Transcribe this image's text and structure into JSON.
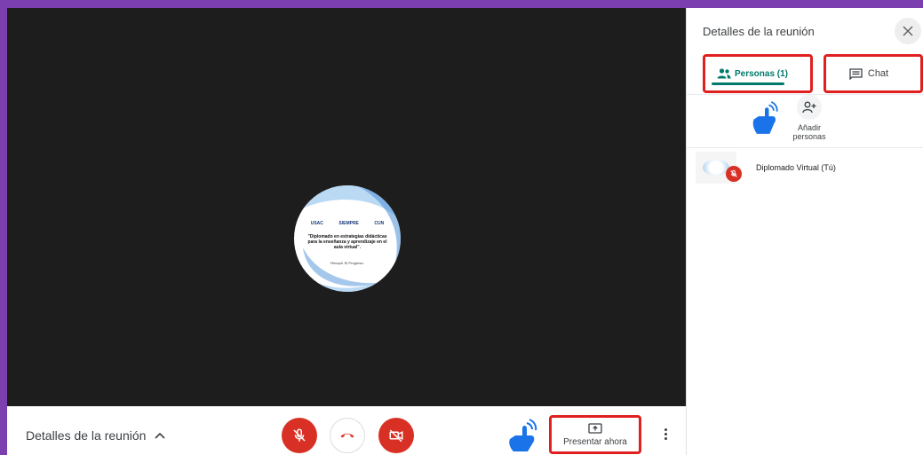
{
  "stage": {
    "avatar_logo_left": "USAC",
    "avatar_logo_mid": "SIEMPRE",
    "avatar_logo_right": "CUN",
    "avatar_title": "\"Diplomado en estrategias didácticas para la enseñanza y aprendizaje en el aula virtual\".",
    "avatar_footer": "Recopil. El Progreso."
  },
  "bottom_bar": {
    "details_label": "Detalles de la reunión",
    "present_label": "Presentar ahora"
  },
  "panel": {
    "title": "Detalles de la reunión",
    "tabs": [
      {
        "label": "Personas (1)"
      },
      {
        "label": "Chat"
      }
    ],
    "add_people_line1": "Añadir",
    "add_people_line2": "personas",
    "participants": [
      {
        "name": "Diplomado Virtual (Tú)"
      }
    ]
  },
  "colors": {
    "accent": "#00796b",
    "danger": "#d93025",
    "stage_bg": "#1d1d1d",
    "highlight": "#e02020",
    "frame_border": "#7b3fb0"
  },
  "icons": [
    "chevron-up-icon",
    "mic-off-icon",
    "call-end-icon",
    "videocam-off-icon",
    "present-screen-icon",
    "more-vert-icon",
    "close-icon",
    "people-icon",
    "chat-icon",
    "person-add-icon",
    "hand-pointer-icon"
  ]
}
